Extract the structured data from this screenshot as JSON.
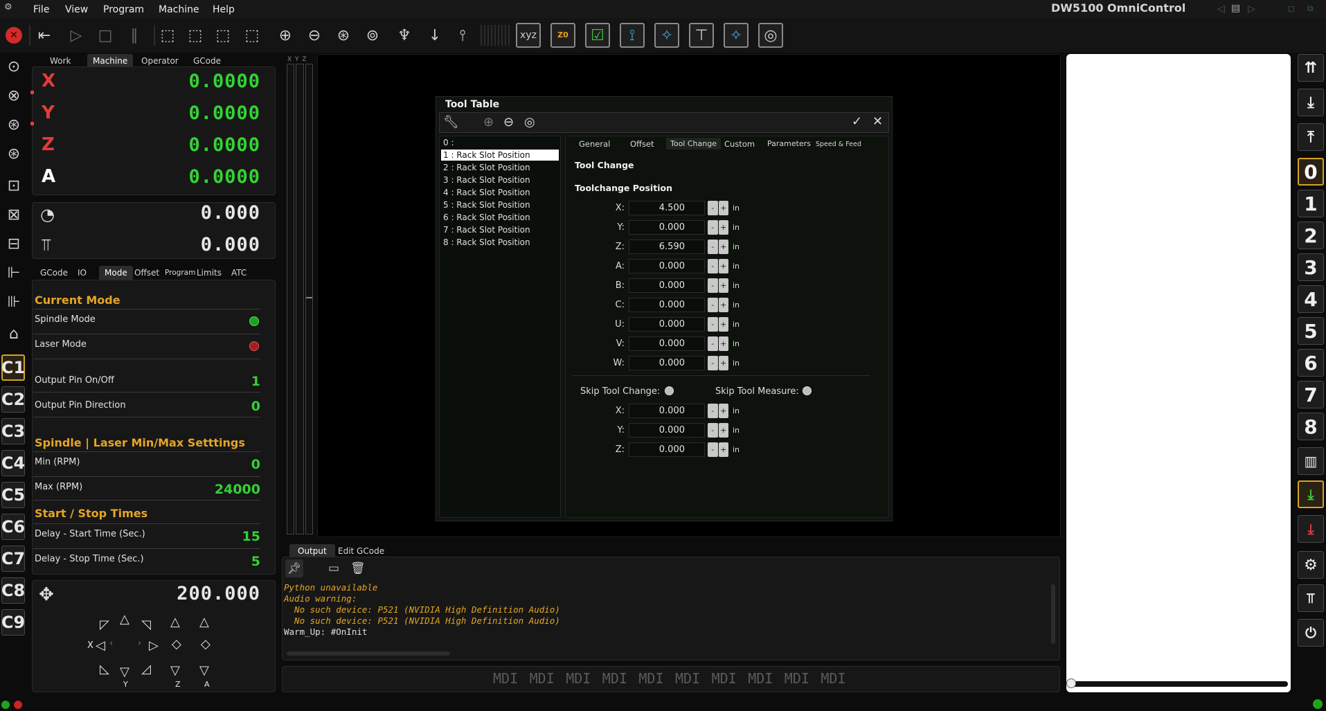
{
  "menubar": {
    "items": [
      "File",
      "View",
      "Program",
      "Machine",
      "Help"
    ],
    "title": "DW5100 OmniControl"
  },
  "dro": {
    "tabs": [
      "Work",
      "Machine",
      "Operator",
      "GCode"
    ],
    "active_tab": "Machine",
    "axes": [
      {
        "name": "X",
        "value": "0.0000",
        "color": "#e33b3b"
      },
      {
        "name": "Y",
        "value": "0.0000",
        "color": "#e33b3b"
      },
      {
        "name": "Z",
        "value": "0.0000",
        "color": "#e33b3b"
      },
      {
        "name": "A",
        "value": "0.0000",
        "color": "#ffffff"
      }
    ]
  },
  "gauges": {
    "feed": "0.000",
    "spindle": "0.000"
  },
  "mode_panel": {
    "tabs": [
      "GCode",
      "IO",
      "Mode",
      "Offset",
      "Program",
      "Limits",
      "ATC"
    ],
    "active_tab": "Mode",
    "current_mode_title": "Current Mode",
    "spindle_mode": "Spindle Mode",
    "laser_mode": "Laser Mode",
    "output_pin_onoff": {
      "label": "Output Pin On/Off",
      "value": "1"
    },
    "output_pin_direction": {
      "label": "Output Pin Direction",
      "value": "0"
    },
    "minmax_title": "Spindle | Laser Min/Max Setttings",
    "min_rpm": {
      "label": "Min (RPM)",
      "value": "0"
    },
    "max_rpm": {
      "label": "Max (RPM)",
      "value": "24000"
    },
    "startstop_title": "Start / Stop Times",
    "delay_start": {
      "label": "Delay - Start Time (Sec.)",
      "value": "15"
    },
    "delay_stop": {
      "label": "Delay - Stop Time (Sec.)",
      "value": "5"
    }
  },
  "jog": {
    "step": "200.000",
    "labels": {
      "x": "X",
      "y": "Y",
      "z": "Z",
      "a": "A"
    }
  },
  "left_buttons": [
    "C1",
    "C2",
    "C3",
    "C4",
    "C5",
    "C6",
    "C7",
    "C8",
    "C9"
  ],
  "right_buttons": [
    "0",
    "1",
    "2",
    "3",
    "4",
    "5",
    "6",
    "7",
    "8"
  ],
  "axis_bar_labels": "X Y Z",
  "tool_table": {
    "title": "Tool Table",
    "tools": [
      "0 :",
      "1 : Rack Slot Position",
      "2 : Rack Slot Position",
      "3 : Rack Slot Position",
      "4 : Rack Slot Position",
      "5 : Rack Slot Position",
      "6 : Rack Slot Position",
      "7 : Rack Slot Position",
      "8 : Rack Slot Position"
    ],
    "selected_index": 1,
    "tabs": [
      "General",
      "Offset",
      "Tool Change",
      "Custom",
      "Parameters",
      "Speed & Feed"
    ],
    "active_tab": "Tool Change",
    "section_title": "Tool Change",
    "position_title": "Toolchange Position",
    "unit": "in",
    "position_fields": [
      {
        "label": "X:",
        "value": "4.500"
      },
      {
        "label": "Y:",
        "value": "0.000"
      },
      {
        "label": "Z:",
        "value": "6.590"
      },
      {
        "label": "A:",
        "value": "0.000"
      },
      {
        "label": "B:",
        "value": "0.000"
      },
      {
        "label": "C:",
        "value": "0.000"
      },
      {
        "label": "U:",
        "value": "0.000"
      },
      {
        "label": "V:",
        "value": "0.000"
      },
      {
        "label": "W:",
        "value": "0.000"
      }
    ],
    "skip_tool_change": "Skip Tool Change:",
    "skip_tool_measure": "Skip Tool Measure:",
    "skip_fields": [
      {
        "label": "X:",
        "value": "0.000"
      },
      {
        "label": "Y:",
        "value": "0.000"
      },
      {
        "label": "Z:",
        "value": "0.000"
      }
    ]
  },
  "output": {
    "tabs": [
      "Output",
      "Edit GCode"
    ],
    "active_tab": "Output",
    "lines": [
      {
        "text": "Python unavailable",
        "color": "#e6a623"
      },
      {
        "text": "Audio warning:",
        "color": "#e6a623"
      },
      {
        "text": "  No such device: P521 (NVIDIA High Definition Audio)",
        "color": "#e6a623"
      },
      {
        "text": "  No such device: P521 (NVIDIA High Definition Audio)",
        "color": "#e6a623"
      },
      {
        "text": "Warm_Up: #OnInit",
        "color": "#e0e0e0"
      }
    ]
  },
  "mdi": {
    "label": "MDI"
  },
  "colors": {
    "accent": "#e6a623",
    "green": "#33d333",
    "red": "#e33b3b",
    "bg": "#0c0c0c"
  }
}
